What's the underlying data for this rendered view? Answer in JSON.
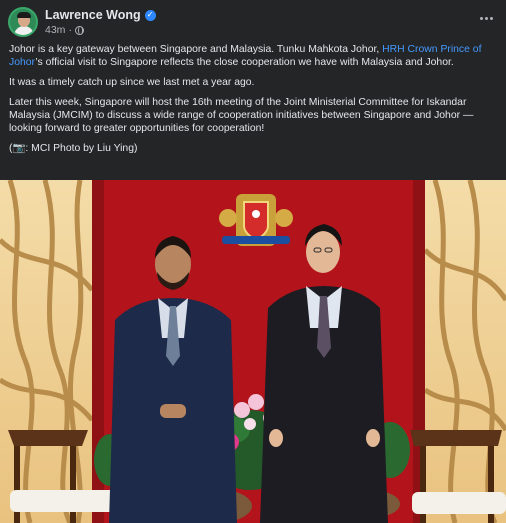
{
  "post": {
    "author_name": "Lawrence Wong",
    "timestamp": "43m",
    "paragraph1_before": "Johor is a key gateway between Singapore and Malaysia. Tunku Mahkota Johor, ",
    "paragraph1_link": "HRH Crown Prince of Johor",
    "paragraph1_after": "’s official visit to Singapore reflects the close cooperation we have with Malaysia and Johor.",
    "paragraph2": "It was a timely catch up since we last met a year ago.",
    "paragraph3": "Later this week, Singapore will host the 16th meeting of the Joint Ministerial Committee for Iskandar Malaysia (JMCIM) to discuss a wide range of cooperation initiatives between Singapore and Johor — looking forward to greater opportunities for cooperation!",
    "photo_credit": "(📷: MCI Photo by Liu Ying)"
  },
  "colors": {
    "background": "#242526",
    "text": "#e4e6eb",
    "secondary_text": "#b0b3b8",
    "link": "#4599ff",
    "verified_badge": "#2d88ff",
    "photo_red_wall": "#b3141b"
  },
  "icons": {
    "verified": "verified-badge-icon",
    "audience": "globe-icon",
    "more": "more-options-icon"
  }
}
